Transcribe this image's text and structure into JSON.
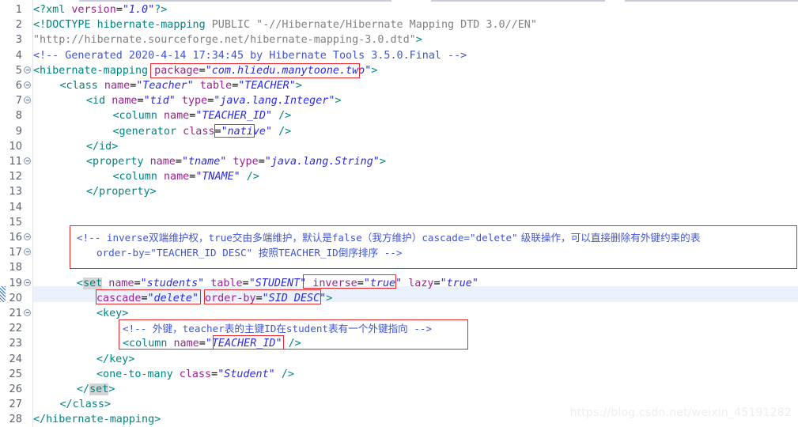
{
  "editor": {
    "kind": "xml-source-editor",
    "filename_content": "hibernate mapping xml",
    "current_line": 20,
    "total_lines_shown": 28,
    "colors": {
      "tag": "#008484",
      "attribute": "#9b2193",
      "value": "#2a2ae0",
      "comment": "#3f55d0",
      "doctype_string": "#808080",
      "annotation_box": "#e8262a",
      "current_line_bg": "#eaf1fb",
      "occurrence_highlight": "#d4d4d4",
      "gutter_text": "#5c6370"
    }
  },
  "gutter": {
    "numbers": [
      "1",
      "2",
      "3",
      "4",
      "5",
      "6",
      "7",
      "8",
      "9",
      "10",
      "11",
      "12",
      "13",
      "14",
      "15",
      "16",
      "17",
      "18",
      "19",
      "20",
      "21",
      "22",
      "23",
      "24",
      "25",
      "26",
      "27",
      "28"
    ],
    "fold_marker_lines": [
      5,
      6,
      7,
      11,
      16,
      17,
      19,
      21
    ],
    "fold_icon_name": "collapse-fold-icon"
  },
  "lines": {
    "l1": "<?xml version=\"1.0\"?>",
    "l2": "<!DOCTYPE hibernate-mapping PUBLIC \"-//Hibernate/Hibernate Mapping DTD 3.0//EN\"",
    "l3": "\"http://hibernate.sourceforge.net/hibernate-mapping-3.0.dtd\">",
    "l4": "<!-- Generated 2020-4-14 17:34:45 by Hibernate Tools 3.5.0.Final -->",
    "l5": "<hibernate-mapping package=\"com.hliedu.manytoone.two\">",
    "l6": "    <class name=\"Teacher\" table=\"TEACHER\">",
    "l7": "        <id name=\"tid\" type=\"java.lang.Integer\">",
    "l8": "            <column name=\"TEACHER_ID\" />",
    "l9": "            <generator class=\"native\" />",
    "l10": "        </id>",
    "l11": "        <property name=\"tname\" type=\"java.lang.String\">",
    "l12": "            <column name=\"TNAME\" />",
    "l13": "        </property>",
    "l14": "",
    "l15": "",
    "l16": "        <!-- inverse双端维护权，true交由多端维护，默认是false（我方维护）cascade=\"delete\" 级联操作，可以直接删除有外键约束的表",
    "l17": "            order-by=\"TEACHER_ID DESC\" 按照TEACHER_ID倒序排序 -->",
    "l18": "",
    "l19": "        <set name=\"students\" table=\"STUDENT\" inverse=\"true\" lazy=\"true\"",
    "l20": "            cascade=\"delete\" order-by=\"SID DESC\">",
    "l21": "            <key>",
    "l22": "                <!-- 外键，teacher表的主键ID在student表有一个外键指向 -->",
    "l23": "                <column name=\"TEACHER_ID\" />",
    "l24": "            </key>",
    "l25": "            <one-to-many class=\"Student\" />",
    "l26": "        </set>",
    "l27": "    </class>",
    "l28": "</hibernate-mapping>"
  },
  "tokens": {
    "l1": {
      "open": "<?xml",
      "attr": "version",
      "eq": "=",
      "val": "\"1.0\"",
      "close": "?>"
    },
    "l2": {
      "open": "<!DOCTYPE",
      "name": " hibernate-mapping ",
      "kw": "PUBLIC",
      "str": " \"-//Hibernate/Hibernate Mapping DTD 3.0//EN\""
    },
    "l3": {
      "str": "\"http://hibernate.sourceforge.net/hibernate-mapping-3.0.dtd\"",
      "close": ">"
    },
    "l4": {
      "comment": "<!-- Generated 2020-4-14 17:34:45 by Hibernate Tools 3.5.0.Final -->"
    },
    "l5": {
      "open": "<hibernate-mapping",
      "attr": " package",
      "eq": "=",
      "val": "\"com.hliedu.manytoone.two\"",
      "close": ">"
    },
    "l6": {
      "open": "<class",
      "attr1": " name",
      "val1": "\"Teacher\"",
      "attr2": " table",
      "val2": "\"TEACHER\"",
      "close": ">"
    },
    "l7": {
      "open": "<id",
      "attr1": " name",
      "val1": "\"tid\"",
      "attr2": " type",
      "val2": "\"java.lang.Integer\"",
      "close": ">"
    },
    "l8": {
      "open": "<column",
      "attr1": " name",
      "val1": "\"TEACHER_ID\"",
      "close": " />"
    },
    "l9": {
      "open": "<generator",
      "attr1": " class",
      "val1": "\"native\"",
      "close": " />"
    },
    "l10": {
      "close": "</id>"
    },
    "l11": {
      "open": "<property",
      "attr1": " name",
      "val1": "\"tname\"",
      "attr2": " type",
      "val2": "\"java.lang.String\"",
      "close": ">"
    },
    "l12": {
      "open": "<column",
      "attr1": " name",
      "val1": "\"TNAME\"",
      "close": " />"
    },
    "l13": {
      "close": "</property>"
    },
    "l16": {
      "comment_a": "<!-- inverse",
      "cjk_a": "双端维护权，",
      "lat_a": "true",
      "cjk_b": "交由多端维护，默认是",
      "lat_b": "false",
      "cjk_c": "（我方维护）",
      "lat_c": "cascade=\"delete\"",
      "cjk_d": " 级联操作，可以直接删除有外键约束的表"
    },
    "l17": {
      "lat_a": "order-by=\"TEACHER_ID DESC\" ",
      "cjk_a": "按照",
      "lat_b": "TEACHER_ID",
      "cjk_b": "倒序排序",
      "lat_c": " -->"
    },
    "l19": {
      "open": "<",
      "occ": "set",
      "attr1": " name",
      "val1": "\"students\"",
      "attr2": " table",
      "val2": "\"STUDENT\"",
      "attr3": " inverse",
      "val3": "\"true\"",
      "attr4": " lazy",
      "val4": "\"true\""
    },
    "l20": {
      "attr1": "cascade",
      "val1": "\"delete\"",
      "attr2": " order-by",
      "val2": "\"SID DESC\"",
      "close": ">"
    },
    "l21": {
      "open": "<key>"
    },
    "l22": {
      "lat_a": "<!-- ",
      "cjk_a": "外键，",
      "lat_b": "teacher",
      "cjk_b": "表的主键",
      "lat_c": "ID",
      "cjk_c": "在",
      "lat_d": "student",
      "cjk_d": "表有一个外键指向",
      "lat_e": " -->"
    },
    "l23": {
      "open": "<column",
      "attr1": " name",
      "val1": "\"TEACHER_ID\"",
      "close": " />"
    },
    "l24": {
      "close": "</key>"
    },
    "l25": {
      "open": "<one-to-many",
      "attr1": " class",
      "val1": "\"Student\"",
      "close": " />"
    },
    "l26": {
      "pre": "</",
      "occ": "set",
      "post": ">"
    },
    "l27": {
      "close": "</class>"
    },
    "l28": {
      "close": "</hibernate-mapping>"
    }
  },
  "annotations": {
    "boxes": [
      {
        "name": "package-attribute-box",
        "label": "package=\"com.hliedu.manytoone.two\""
      },
      {
        "name": "generator-native-box",
        "label": "native"
      },
      {
        "name": "inverse-comment-box",
        "label": "inverse / order-by explanation comment"
      },
      {
        "name": "inverse-attribute-box",
        "label": "inverse=\"true\""
      },
      {
        "name": "cascade-attribute-box",
        "label": "cascade=\"delete\""
      },
      {
        "name": "order-by-attribute-box",
        "label": "order-by=\"SID DESC\""
      },
      {
        "name": "foreign-key-comment-box",
        "label": "foreign key comment + column"
      },
      {
        "name": "teacher-id-value-box",
        "label": "TEACHER_ID"
      }
    ]
  },
  "watermark": {
    "text": "https://blog.csdn.net/weixin_45191282"
  }
}
